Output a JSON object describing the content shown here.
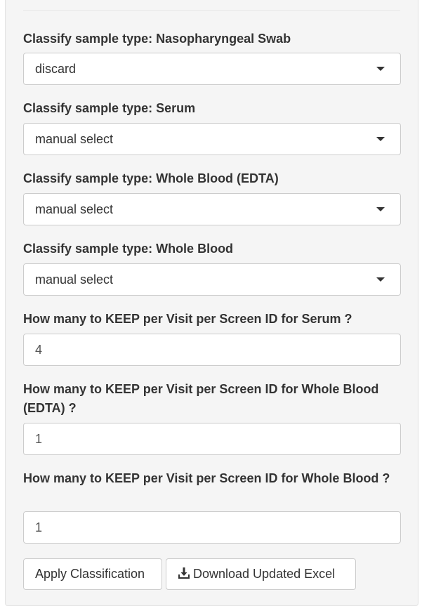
{
  "classify": [
    {
      "label": "Classify sample type: Nasopharyngeal Swab",
      "value": "discard"
    },
    {
      "label": "Classify sample type: Serum",
      "value": "manual select"
    },
    {
      "label": "Classify sample type: Whole Blood (EDTA)",
      "value": "manual select"
    },
    {
      "label": "Classify sample type: Whole Blood",
      "value": "manual select"
    }
  ],
  "keep": [
    {
      "label": "How many to KEEP per Visit per Screen ID for Serum ?",
      "value": "4"
    },
    {
      "label": "How many to KEEP per Visit per Screen ID for Whole Blood (EDTA) ?",
      "value": "1"
    },
    {
      "label": "How many to KEEP per Visit per Screen ID for Whole Blood ?",
      "value": "1"
    }
  ],
  "buttons": {
    "apply_label": "Apply Classification",
    "download_label": "Download Updated Excel",
    "download_icon": "download-icon"
  }
}
